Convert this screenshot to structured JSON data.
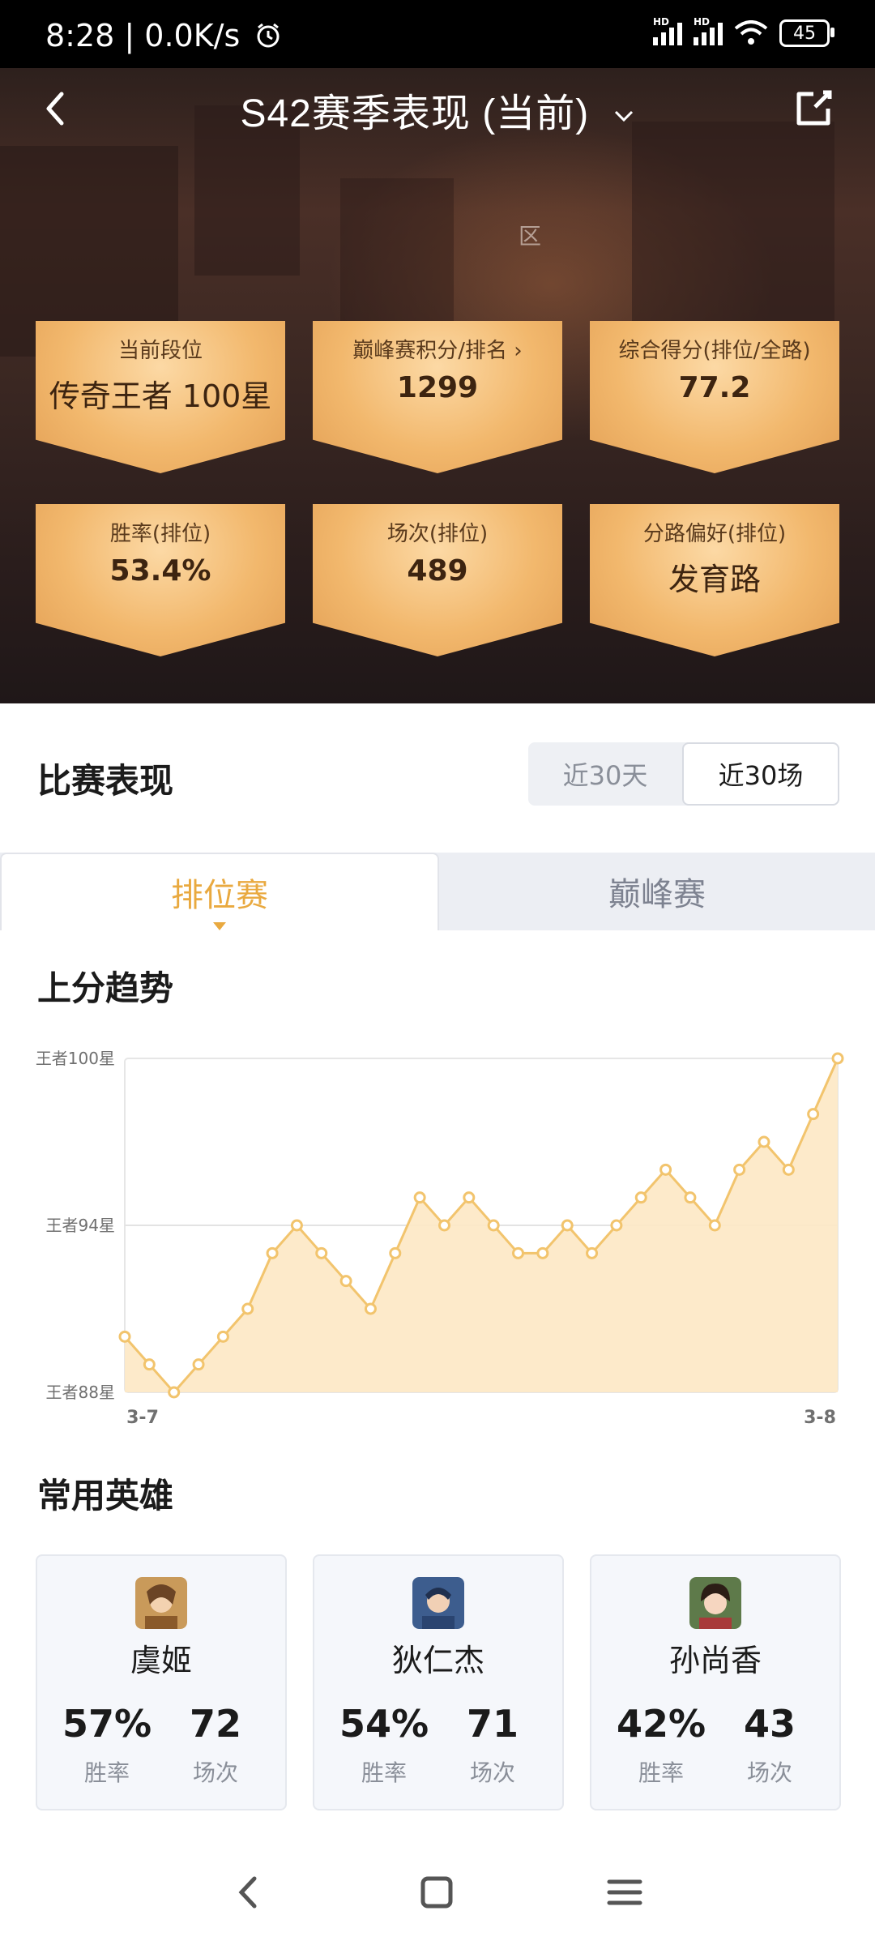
{
  "status_bar": {
    "time_speed": "8:28 | 0.0K/s",
    "signal_label": "HD",
    "battery": "45"
  },
  "header": {
    "title": "S42赛季表现 (当前)",
    "region_hint": "区"
  },
  "stats": [
    {
      "label": "当前段位",
      "value": "传奇王者 100星"
    },
    {
      "label": "巅峰赛积分/排名 ›",
      "value": "1299"
    },
    {
      "label": "综合得分(排位/全路)",
      "value": "77.2"
    },
    {
      "label": "胜率(排位)",
      "value": "53.4%"
    },
    {
      "label": "场次(排位)",
      "value": "489"
    },
    {
      "label": "分路偏好(排位)",
      "value": "发育路"
    }
  ],
  "performance": {
    "title": "比赛表现",
    "segments": [
      "近30天",
      "近30场"
    ],
    "selected_segment": "近30场",
    "tabs": [
      "排位赛",
      "巅峰赛"
    ],
    "active_tab": "排位赛"
  },
  "trend": {
    "title": "上分趋势"
  },
  "chart_data": {
    "type": "area",
    "title": "上分趋势",
    "xlabel": "",
    "ylabel": "",
    "x_tick_labels": [
      "3-7",
      "3-8"
    ],
    "y_tick_labels": [
      "王者100星",
      "王者94星",
      "王者88星"
    ],
    "ylim": [
      88,
      100
    ],
    "grid": true,
    "series": [
      {
        "values": [
          90,
          89,
          88,
          89,
          90,
          91,
          93,
          94,
          93,
          92,
          91,
          93,
          95,
          94,
          95,
          94,
          93,
          93,
          94,
          93,
          94,
          95,
          96,
          95,
          94,
          96,
          97,
          96,
          98,
          100
        ]
      }
    ],
    "colors": {
      "line": "#f2c46d",
      "fill": "#fde8c4",
      "marker_fill": "#ffffff"
    }
  },
  "heroes_section": {
    "title": "常用英雄",
    "heroes": [
      {
        "name": "虞姬",
        "winrate": "57%",
        "winrate_label": "胜率",
        "games": "72",
        "games_label": "场次"
      },
      {
        "name": "狄仁杰",
        "winrate": "54%",
        "winrate_label": "胜率",
        "games": "71",
        "games_label": "场次"
      },
      {
        "name": "孙尚香",
        "winrate": "42%",
        "winrate_label": "胜率",
        "games": "43",
        "games_label": "场次"
      }
    ]
  },
  "icons": [
    "back-arrow-icon",
    "chevron-down-icon",
    "share-icon",
    "alarm-icon",
    "wifi-icon",
    "battery-icon",
    "nav-back-icon",
    "nav-home-icon",
    "nav-menu-icon"
  ]
}
